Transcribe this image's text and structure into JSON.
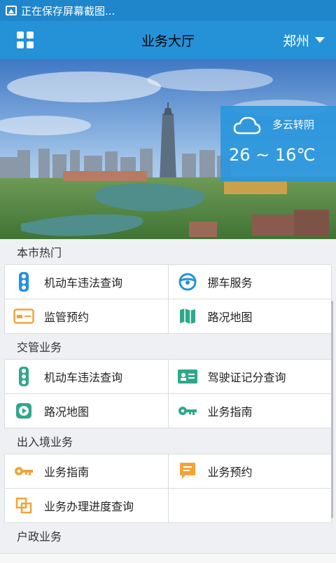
{
  "status": {
    "text": "正在保存屏幕截图..."
  },
  "header": {
    "title": "业务大厅",
    "city": "郑州"
  },
  "weather": {
    "desc": "多云转阴",
    "temp": "26 ~ 16℃"
  },
  "sections": [
    {
      "title": "本市热门",
      "items": [
        {
          "label": "机动车违法查询",
          "icon": "traffic-light-icon"
        },
        {
          "label": "挪车服务",
          "icon": "steering-wheel-icon"
        },
        {
          "label": "监管预约",
          "icon": "card-icon"
        },
        {
          "label": "路况地图",
          "icon": "map-icon"
        }
      ]
    },
    {
      "title": "交管业务",
      "items": [
        {
          "label": "机动车违法查询",
          "icon": "traffic-light-icon"
        },
        {
          "label": "驾驶证记分查询",
          "icon": "license-icon"
        },
        {
          "label": "路况地图",
          "icon": "play-icon"
        },
        {
          "label": "业务指南",
          "icon": "key-icon"
        }
      ]
    },
    {
      "title": "出入境业务",
      "items": [
        {
          "label": "业务指南",
          "icon": "key-icon"
        },
        {
          "label": "业务预约",
          "icon": "message-icon"
        },
        {
          "label": "业务办理进度查询",
          "icon": "copy-icon"
        },
        {
          "label": "",
          "icon": ""
        }
      ]
    },
    {
      "title": "户政业务"
    }
  ],
  "colors": {
    "header": "#2592d8",
    "statusbar": "#1f86cb",
    "weather_bg": "#2a96dc"
  }
}
